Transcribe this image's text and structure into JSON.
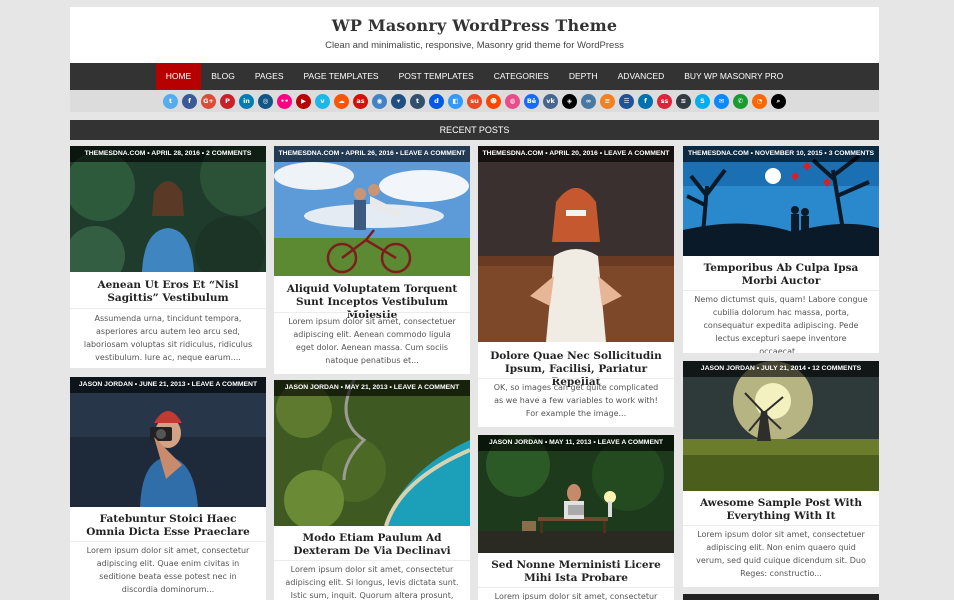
{
  "header": {
    "title": "WP Masonry WordPress Theme",
    "description": "Clean and minimalistic, responsive, Masonry grid theme for WordPress"
  },
  "nav": {
    "items": [
      {
        "label": "HOME",
        "active": true
      },
      {
        "label": "BLOG"
      },
      {
        "label": "PAGES"
      },
      {
        "label": "PAGE TEMPLATES"
      },
      {
        "label": "POST TEMPLATES"
      },
      {
        "label": "CATEGORIES"
      },
      {
        "label": "DEPTH"
      },
      {
        "label": "ADVANCED"
      },
      {
        "label": "BUY WP MASONRY PRO"
      }
    ]
  },
  "social": [
    {
      "name": "twitter-icon",
      "glyph": "t",
      "color": "#55acee"
    },
    {
      "name": "facebook-icon",
      "glyph": "f",
      "color": "#3b5998"
    },
    {
      "name": "google-plus-icon",
      "glyph": "G+",
      "color": "#dd4b39"
    },
    {
      "name": "pinterest-icon",
      "glyph": "P",
      "color": "#cb2027"
    },
    {
      "name": "linkedin-icon",
      "glyph": "in",
      "color": "#007bb5"
    },
    {
      "name": "instagram-icon",
      "glyph": "◎",
      "color": "#125688"
    },
    {
      "name": "flickr-icon",
      "glyph": "••",
      "color": "#ff0084"
    },
    {
      "name": "youtube-icon",
      "glyph": "▶",
      "color": "#bb0000"
    },
    {
      "name": "vimeo-icon",
      "glyph": "v",
      "color": "#1ab7ea"
    },
    {
      "name": "soundcloud-icon",
      "glyph": "☁",
      "color": "#ff5500"
    },
    {
      "name": "lastfm-icon",
      "glyph": "as",
      "color": "#d51007"
    },
    {
      "name": "github-icon",
      "glyph": "◉",
      "color": "#4183c4"
    },
    {
      "name": "bitbucket-icon",
      "glyph": "▾",
      "color": "#205081"
    },
    {
      "name": "tumblr-icon",
      "glyph": "t",
      "color": "#32506d"
    },
    {
      "name": "digg-icon",
      "glyph": "d",
      "color": "#005be2"
    },
    {
      "name": "delicious-icon",
      "glyph": "◧",
      "color": "#3399ff"
    },
    {
      "name": "stumbleupon-icon",
      "glyph": "su",
      "color": "#eb4924"
    },
    {
      "name": "reddit-icon",
      "glyph": "☻",
      "color": "#ff4500"
    },
    {
      "name": "dribbble-icon",
      "glyph": "◍",
      "color": "#ea4c89"
    },
    {
      "name": "behance-icon",
      "glyph": "Bē",
      "color": "#1769ff"
    },
    {
      "name": "vk-icon",
      "glyph": "vk",
      "color": "#45668e"
    },
    {
      "name": "codepen-icon",
      "glyph": "◈",
      "color": "#000000"
    },
    {
      "name": "jsfiddle-icon",
      "glyph": "∞",
      "color": "#4679a4"
    },
    {
      "name": "stackoverflow-icon",
      "glyph": "≡",
      "color": "#f48024"
    },
    {
      "name": "stackexchange-icon",
      "glyph": "☰",
      "color": "#1e5397"
    },
    {
      "name": "foursquare-icon",
      "glyph": "f",
      "color": "#0072b1"
    },
    {
      "name": "slideshare-icon",
      "glyph": "ss",
      "color": "#e1233a"
    },
    {
      "name": "buffer-icon",
      "glyph": "≋",
      "color": "#323b43"
    },
    {
      "name": "skype-icon",
      "glyph": "S",
      "color": "#00aff0"
    },
    {
      "name": "email-icon",
      "glyph": "✉",
      "color": "#0a88ff"
    },
    {
      "name": "phone-icon",
      "glyph": "✆",
      "color": "#1a9b31"
    },
    {
      "name": "rss-icon",
      "glyph": "◔",
      "color": "#ff6600"
    },
    {
      "name": "search-icon",
      "glyph": "⌕",
      "color": "#000000"
    }
  ],
  "recent_posts_label": "RECENT POSTS",
  "posts": [
    {
      "meta": "THEMESDNA.COM  •  APRIL 28, 2016  •  2 COMMENTS",
      "title": "Aenean Ut Eros Et “Nisl Sagittis” Vestibulum",
      "excerpt": "Assumenda urna, tincidunt tempora, asperiores arcu autem leo arcu sed, laboriosam voluptas sit ridiculus, ridiculus vestibulum. Iure ac, neque earum...."
    },
    {
      "meta": "THEMESDNA.COM  •  APRIL 26, 2016  •  LEAVE A COMMENT",
      "title": "Aliquid Voluptatem Torquent Sunt Inceptos Vestibulum Molestie",
      "excerpt": "Lorem ipsum dolor sit amet, consectetuer adipiscing elit. Aenean commodo ligula eget dolor. Aenean massa. Cum sociis natoque penatibus et..."
    },
    {
      "meta": "THEMESDNA.COM  •  APRIL 20, 2016  •  LEAVE A COMMENT",
      "title": "Dolore Quae Nec Sollicitudin Ipsum, Facilisi, Pariatur Repellat",
      "excerpt": "OK, so images can get quite complicated as we have a few variables to work with! For example the image..."
    },
    {
      "meta": "THEMESDNA.COM  •  NOVEMBER 10, 2015  •  3 COMMENTS",
      "title": "Temporibus Ab Culpa Ipsa Morbi Auctor",
      "excerpt": "Nemo dictumst quis, quam! Labore congue cubilia dolorum hac massa, porta, consequatur expedita adipiscing. Pede lectus excepturi saepe inventore occaecat..."
    },
    {
      "meta": "JASON JORDAN  •  JUNE 21, 2013  •  LEAVE A COMMENT",
      "title": "Fatebuntur Stoici Haec Omnia Dicta Esse Praeclare",
      "excerpt": "Lorem ipsum dolor sit amet, consectetur adipiscing elit. Quae enim civitas in seditione beata esse potest nec in discordia dominorum..."
    },
    {
      "meta": "JASON JORDAN  •  MAY 21, 2013  •  LEAVE A COMMENT",
      "title": "Modo Etiam Paulum Ad Dexteram De Via Declinavi",
      "excerpt": "Lorem ipsum dolor sit amet, consectetur adipiscing elit. Si longus, levis dictata sunt. Istic sum, inquit. Quorum altera prosunt,"
    },
    {
      "meta": "JASON JORDAN  •  MAY 11, 2013  •  LEAVE A COMMENT",
      "title": "Sed Nonne Merninisti Licere Mihi Ista Probare",
      "excerpt": "Lorem ipsum dolor sit amet, consectetur"
    },
    {
      "meta": "JASON JORDAN  •  JULY 21, 2014  •  12 COMMENTS",
      "title": "Awesome Sample Post With Everything With It",
      "excerpt": "Lorem ipsum dolor sit amet, consectetuer adipiscing elit. Non enim quaero quid verum, sed quid cuique dicendum sit. Duo Reges: constructio..."
    }
  ]
}
